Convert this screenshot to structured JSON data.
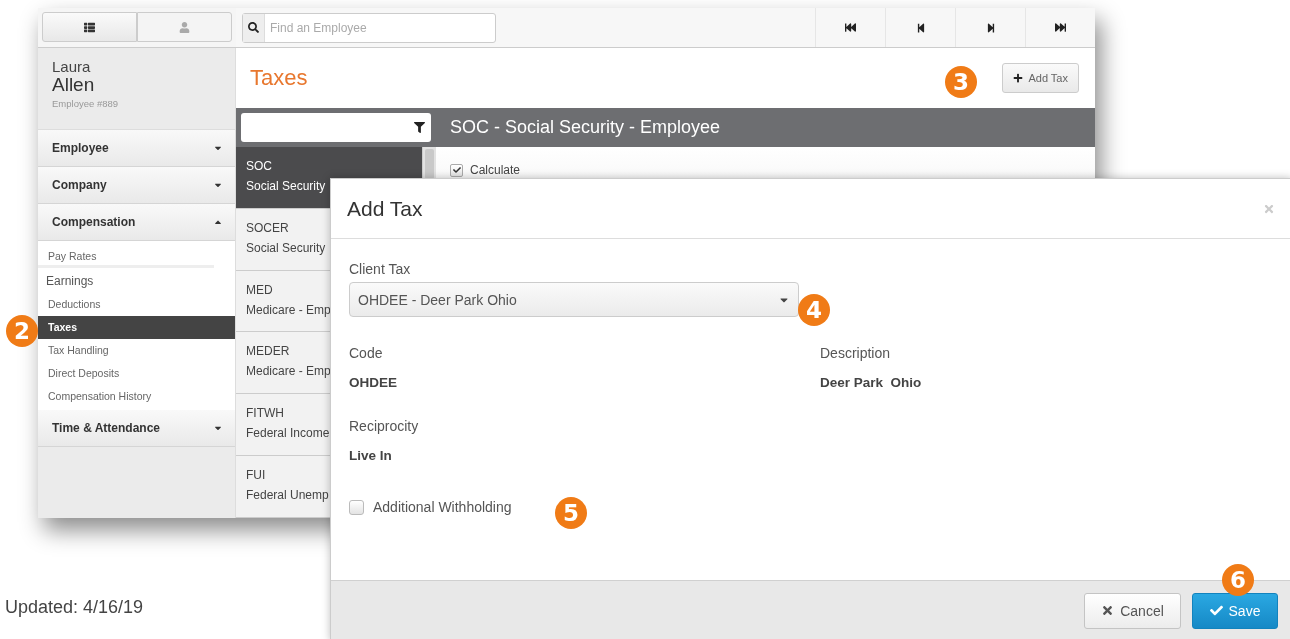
{
  "toolbar": {
    "search": {
      "placeholder": "Find an Employee"
    }
  },
  "employee": {
    "first_name": "Laura",
    "last_name": "Allen",
    "number": "Employee #889"
  },
  "sidebar": {
    "sections": [
      {
        "label": "Employee",
        "expanded": false
      },
      {
        "label": "Company",
        "expanded": false
      },
      {
        "label": "Compensation",
        "expanded": true,
        "items": [
          {
            "label": "Pay Rates",
            "kind": "underlined",
            "selected": false
          },
          {
            "label": "Earnings",
            "kind": "large",
            "selected": false
          },
          {
            "label": "Deductions",
            "kind": "plain",
            "selected": false
          },
          {
            "label": "Taxes",
            "kind": "plain",
            "selected": true
          },
          {
            "label": "Tax Handling",
            "kind": "plain",
            "selected": false
          },
          {
            "label": "Direct Deposits",
            "kind": "plain",
            "selected": false
          },
          {
            "label": "Compensation History",
            "kind": "plain",
            "selected": false
          }
        ]
      },
      {
        "label": "Time & Attendance",
        "expanded": false
      }
    ]
  },
  "page": {
    "title": "Taxes",
    "add_button": "Add Tax"
  },
  "tax_list": {
    "items": [
      {
        "code": "SOC",
        "name": "Social Security",
        "selected": true
      },
      {
        "code": "SOCER",
        "name": "Social Security",
        "selected": false
      },
      {
        "code": "MED",
        "name": "Medicare - Emp",
        "selected": false
      },
      {
        "code": "MEDER",
        "name": "Medicare - Emp",
        "selected": false
      },
      {
        "code": "FITWH",
        "name": "Federal Income",
        "selected": false
      },
      {
        "code": "FUI",
        "name": "Federal Unemp",
        "selected": false
      }
    ]
  },
  "detail": {
    "title": "SOC - Social Security - Employee",
    "calculate": {
      "label": "Calculate",
      "checked": true
    }
  },
  "dialog": {
    "title": "Add Tax",
    "client_tax": {
      "label": "Client Tax",
      "value": "OHDEE - Deer Park Ohio"
    },
    "code": {
      "label": "Code",
      "value": "OHDEE"
    },
    "description": {
      "label": "Description",
      "value": "Deer Park  Ohio"
    },
    "reciprocity": {
      "label": "Reciprocity",
      "value": "Live In"
    },
    "additional_withholding": {
      "label": "Additional Withholding",
      "checked": false
    },
    "buttons": [
      {
        "kind": "cancel",
        "label": "Cancel"
      },
      {
        "kind": "save",
        "label": "Save"
      }
    ]
  },
  "callouts": [
    "2",
    "3",
    "4",
    "5",
    "6"
  ],
  "footer_note": "Updated: 4/16/19"
}
